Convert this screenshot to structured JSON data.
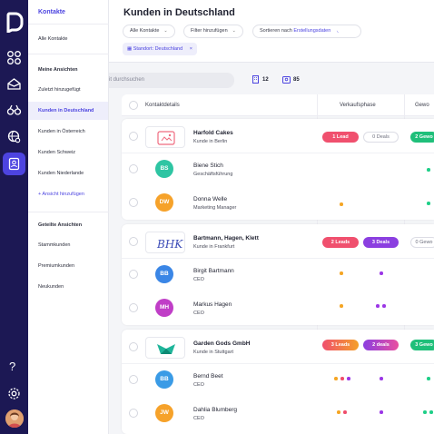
{
  "colors": {
    "rail": "#1c1854",
    "accent": "#4c44e0",
    "lead_red": "#f0506e",
    "deal_purple": "#8b3fe0",
    "won_green": "#1fbf7a",
    "dot_orange": "#f5a524",
    "dot_purple": "#9b36e6",
    "dot_red": "#ef4d6b",
    "dot_green": "#1fcf88"
  },
  "rail": {
    "icons": [
      "logo-icon",
      "grid-icon",
      "inbox-icon",
      "binoculars-icon",
      "globe-icon",
      "contacts-icon",
      "help-icon",
      "settings-icon"
    ],
    "help_label": "?"
  },
  "sidebar": {
    "title": "Kontakte",
    "all_contacts": "Alle Kontakte",
    "my_views_heading": "Meine Ansichten",
    "my_views": [
      "Zuletzt hinzugefügt",
      "Kunden in Deutschland",
      "Kunden in Österreich",
      "Kunden Schweiz",
      "Kunden Niederlande"
    ],
    "add_view": "+  Ansicht hinzufügen",
    "shared_heading": "Geteilte Ansichten",
    "shared_views": [
      "Stammkunden",
      "Premiumkunden",
      "Neukunden"
    ]
  },
  "header": {
    "title": "Kunden in Deutschland",
    "filter_all": "Alle Kontakte",
    "filter_add": "Filter hinzufügen",
    "sort_prefix": "Sortieren nach",
    "sort_value": "Erstellungsdaten",
    "active_filter": "Standort: Deutschland"
  },
  "toolbar": {
    "search_placeholder": "it durchsuchen",
    "company_count": "12",
    "contact_count": "85"
  },
  "table": {
    "columns": [
      "Kontaktdetails",
      "Verkaufsphase",
      "Gewo"
    ],
    "groups": [
      {
        "company": {
          "name": "Harfold Cakes",
          "sub": "Kunde in Berlin",
          "logo": "harfold-logo",
          "badges": [
            "1 Lead",
            "0 Deals",
            "2 Gewo"
          ]
        },
        "contacts": [
          {
            "initials": "BS",
            "name": "Biene Stich",
            "sub": "Geschäftsführung",
            "color": "#2ec5a3"
          },
          {
            "initials": "DW",
            "name": "Donna Welle",
            "sub": "Marketing Manager",
            "color": "#f6a22a"
          }
        ]
      },
      {
        "company": {
          "name": "Bartmann, Hagen, Klett",
          "sub": "Kunde in Frankfurt",
          "logo": "bhk-logo",
          "badges": [
            "2 Leads",
            "3 Deals",
            "0 Gewo"
          ]
        },
        "contacts": [
          {
            "initials": "BB",
            "name": "Birgit Bartmann",
            "sub": "CEO",
            "color": "#3a86e6"
          },
          {
            "initials": "MH",
            "name": "Markus Hagen",
            "sub": "CEO",
            "color": "#c03ec7"
          }
        ]
      },
      {
        "company": {
          "name": "Garden Gods GmbH",
          "sub": "Kunde in Stuttgart",
          "logo": "garden-logo",
          "badges": [
            "3 Leads",
            "2 deals",
            "3 Gewo"
          ]
        },
        "contacts": [
          {
            "initials": "BB",
            "name": "Bernd Beet",
            "sub": "CEO",
            "color": "#3a9be6"
          },
          {
            "initials": "JW",
            "name": "Dahlia Blumberg",
            "sub": "CEO",
            "color": "#f6a22a"
          }
        ]
      }
    ]
  }
}
